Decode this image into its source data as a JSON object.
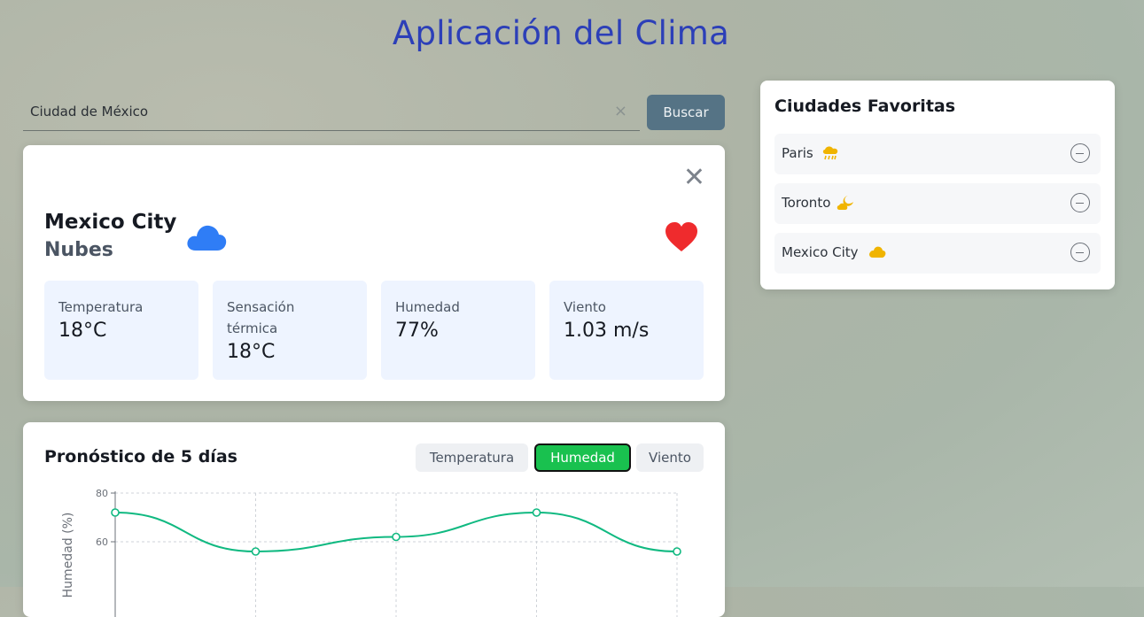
{
  "app": {
    "title": "Aplicación del Clima"
  },
  "search": {
    "value": "Ciudad de México",
    "button_label": "Buscar",
    "clear_glyph": "×"
  },
  "weather": {
    "close_glyph": "✕",
    "city": "Mexico City",
    "condition": "Nubes",
    "condition_icon": "cloud-icon",
    "favorite_icon": "heart-icon",
    "stats": [
      {
        "label": "Temperatura",
        "value": "18°C"
      },
      {
        "label": "Sensación térmica",
        "value": "18°C"
      },
      {
        "label": "Humedad",
        "value": "77%"
      },
      {
        "label": "Viento",
        "value": "1.03 m/s"
      }
    ]
  },
  "favorites": {
    "title": "Ciudades Favoritas",
    "items": [
      {
        "name": "Paris",
        "icon": "rain-cloud-icon"
      },
      {
        "name": "Toronto",
        "icon": "moon-cloud-icon"
      },
      {
        "name": "Mexico City",
        "icon": "cloud-icon"
      }
    ]
  },
  "forecast": {
    "title": "Pronóstico de 5 días",
    "tabs": [
      {
        "label": "Temperatura",
        "active": false
      },
      {
        "label": "Humedad",
        "active": true
      },
      {
        "label": "Viento",
        "active": false
      }
    ]
  },
  "colors": {
    "title": "#2c3fb8",
    "accent_green": "#19c14f",
    "line": "#10b981",
    "heart": "#ef2b2d",
    "cloud_blue": "#2f7df6",
    "weather_yellow": "#f0b400"
  },
  "chart_data": {
    "type": "line",
    "title": "",
    "xlabel": "",
    "ylabel": "Humedad (%)",
    "ylim": [
      40,
      80
    ],
    "yticks": [
      80,
      60
    ],
    "grid": true,
    "series": [
      {
        "values": [
          72,
          56,
          62,
          72,
          56
        ]
      }
    ]
  }
}
